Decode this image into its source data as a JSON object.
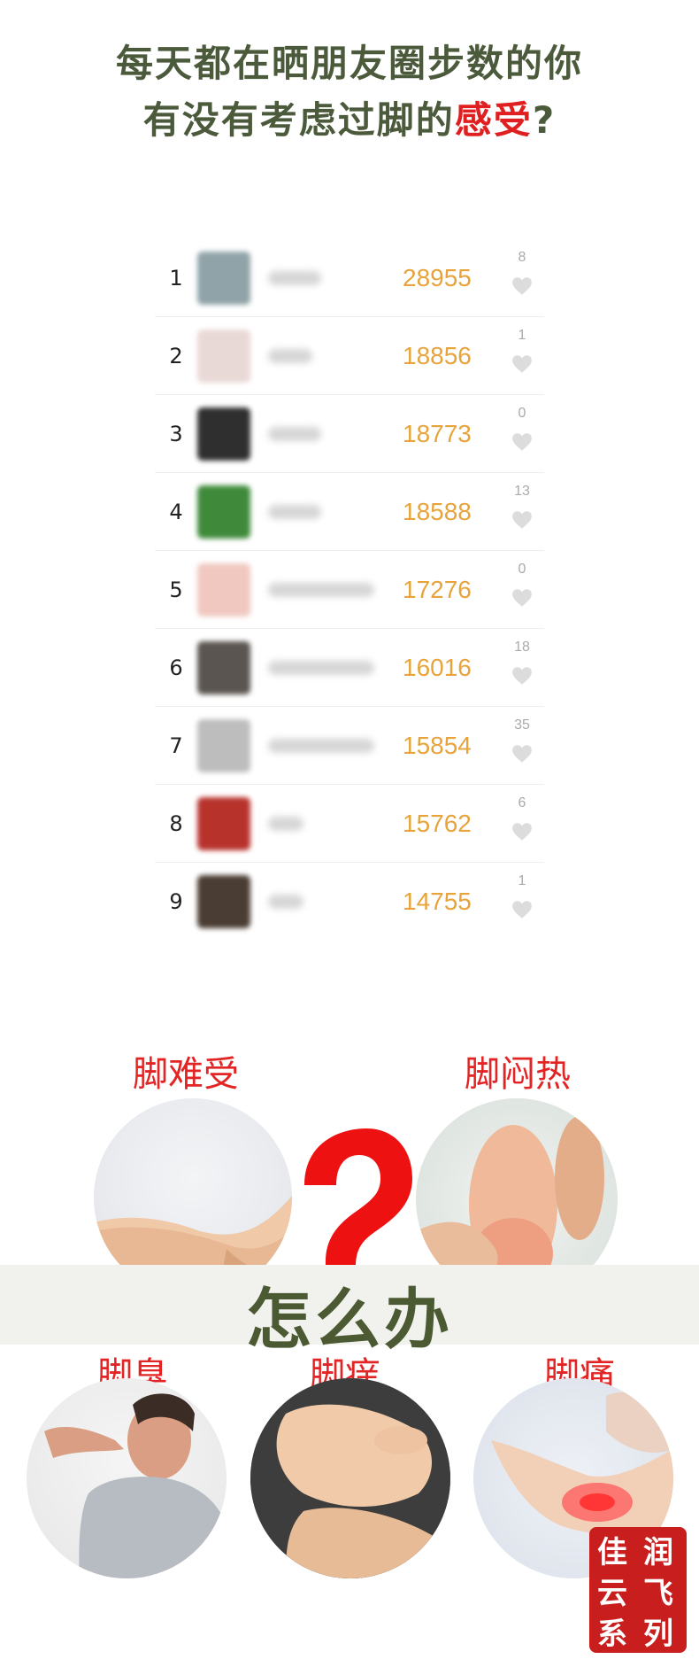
{
  "title": {
    "line1": "每天都在晒朋友圈步数的你",
    "line2_before": "有没有考虑过脚的",
    "line2_highlight": "感受",
    "line2_after": "?"
  },
  "ranking": [
    {
      "rank": "1",
      "steps": "28955",
      "likes": "8",
      "avatar_color": "#8fa3a8"
    },
    {
      "rank": "2",
      "steps": "18856",
      "likes": "1",
      "avatar_color": "#e9d9d6"
    },
    {
      "rank": "3",
      "steps": "18773",
      "likes": "0",
      "avatar_color": "#2f2f2f"
    },
    {
      "rank": "4",
      "steps": "18588",
      "likes": "13",
      "avatar_color": "#3f8a3a"
    },
    {
      "rank": "5",
      "steps": "17276",
      "likes": "0",
      "avatar_color": "#f0c8c0"
    },
    {
      "rank": "6",
      "steps": "16016",
      "likes": "18",
      "avatar_color": "#5a5550"
    },
    {
      "rank": "7",
      "steps": "15854",
      "likes": "35",
      "avatar_color": "#bdbdbd"
    },
    {
      "rank": "8",
      "steps": "15762",
      "likes": "6",
      "avatar_color": "#b8322c"
    },
    {
      "rank": "9",
      "steps": "14755",
      "likes": "1",
      "avatar_color": "#4a3d33"
    }
  ],
  "labels": {
    "foot_uncomfortable": "脚难受",
    "foot_stuffy": "脚闷热",
    "how_to": "怎么办",
    "foot_smelly": "脚臭",
    "foot_itchy": "脚痒",
    "foot_pain": "脚痛"
  },
  "seal": {
    "col_right_top": "润",
    "col_right_mid": "飞",
    "col_right_bot": "列",
    "col_left_top": "佳",
    "col_left_mid": "云",
    "col_left_bot": "系"
  },
  "colors": {
    "title": "#4c5a3c",
    "highlight": "#e02020",
    "steps": "#e8a33a",
    "label_red": "#e32424",
    "question_mark": "#ee1111"
  }
}
